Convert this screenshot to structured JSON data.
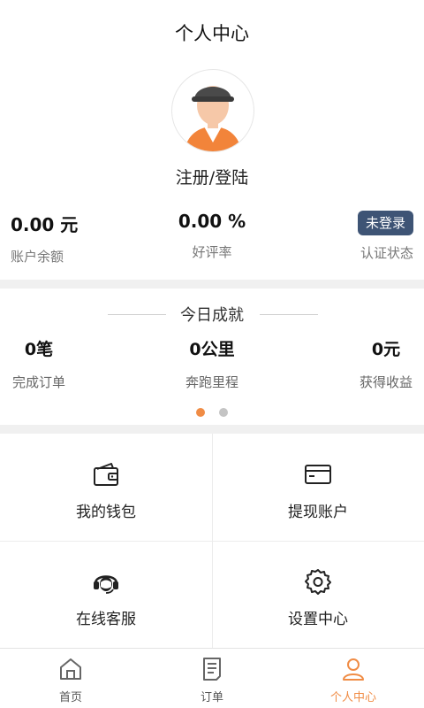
{
  "header": {
    "title": "个人中心"
  },
  "profile": {
    "login_text": "注册/登陆"
  },
  "stats": {
    "balance_value": "0.00 元",
    "balance_label": "账户余额",
    "rating_value": "0.00 %",
    "rating_label": "好评率",
    "auth_badge": "未登录",
    "auth_label": "认证状态"
  },
  "achievement": {
    "title": "今日成就",
    "orders_value": "0笔",
    "orders_label": "完成订单",
    "mileage_value": "0公里",
    "mileage_label": "奔跑里程",
    "income_value": "0元",
    "income_label": "获得收益",
    "pager": {
      "pages": 2,
      "current": 1
    }
  },
  "menu": {
    "wallet": "我的钱包",
    "withdraw_account": "提现账户",
    "customer_service": "在线客服",
    "settings": "设置中心"
  },
  "tabbar": {
    "home": "首页",
    "orders": "订单",
    "profile": "个人中心",
    "active": "profile"
  },
  "colors": {
    "accent": "#f08c45",
    "badge_bg": "#3e5475",
    "divider": "#f0f0f0"
  },
  "icons": {
    "avatar": "avatar-icon",
    "wallet": "wallet-icon",
    "card": "card-icon",
    "headset": "headset-icon",
    "gear": "gear-icon",
    "home": "home-icon",
    "document": "document-icon",
    "user": "user-icon"
  }
}
